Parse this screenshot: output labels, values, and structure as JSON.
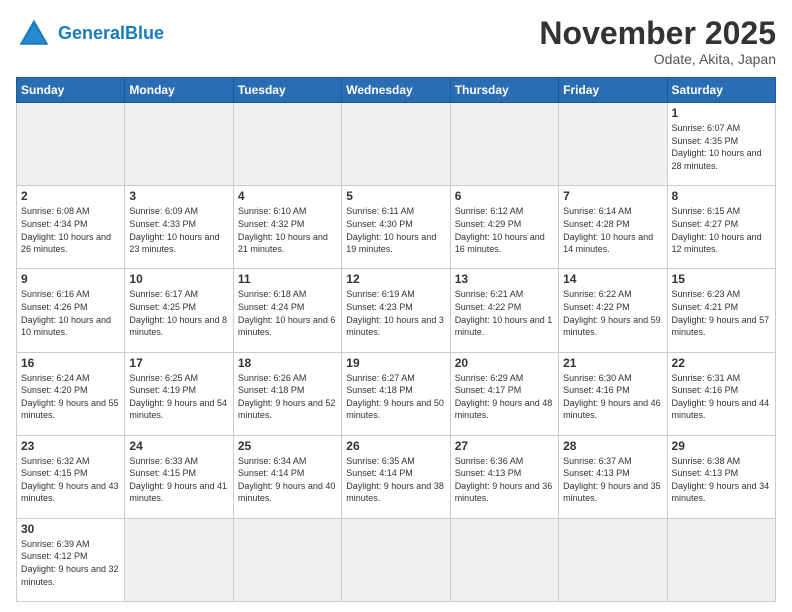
{
  "header": {
    "logo_general": "General",
    "logo_blue": "Blue",
    "month_title": "November 2025",
    "location": "Odate, Akita, Japan"
  },
  "days_of_week": [
    "Sunday",
    "Monday",
    "Tuesday",
    "Wednesday",
    "Thursday",
    "Friday",
    "Saturday"
  ],
  "weeks": [
    [
      {
        "day": "",
        "empty": true
      },
      {
        "day": "",
        "empty": true
      },
      {
        "day": "",
        "empty": true
      },
      {
        "day": "",
        "empty": true
      },
      {
        "day": "",
        "empty": true
      },
      {
        "day": "",
        "empty": true
      },
      {
        "day": "1",
        "sunrise": "Sunrise: 6:07 AM",
        "sunset": "Sunset: 4:35 PM",
        "daylight": "Daylight: 10 hours and 28 minutes."
      }
    ],
    [
      {
        "day": "2",
        "sunrise": "Sunrise: 6:08 AM",
        "sunset": "Sunset: 4:34 PM",
        "daylight": "Daylight: 10 hours and 26 minutes."
      },
      {
        "day": "3",
        "sunrise": "Sunrise: 6:09 AM",
        "sunset": "Sunset: 4:33 PM",
        "daylight": "Daylight: 10 hours and 23 minutes."
      },
      {
        "day": "4",
        "sunrise": "Sunrise: 6:10 AM",
        "sunset": "Sunset: 4:32 PM",
        "daylight": "Daylight: 10 hours and 21 minutes."
      },
      {
        "day": "5",
        "sunrise": "Sunrise: 6:11 AM",
        "sunset": "Sunset: 4:30 PM",
        "daylight": "Daylight: 10 hours and 19 minutes."
      },
      {
        "day": "6",
        "sunrise": "Sunrise: 6:12 AM",
        "sunset": "Sunset: 4:29 PM",
        "daylight": "Daylight: 10 hours and 16 minutes."
      },
      {
        "day": "7",
        "sunrise": "Sunrise: 6:14 AM",
        "sunset": "Sunset: 4:28 PM",
        "daylight": "Daylight: 10 hours and 14 minutes."
      },
      {
        "day": "8",
        "sunrise": "Sunrise: 6:15 AM",
        "sunset": "Sunset: 4:27 PM",
        "daylight": "Daylight: 10 hours and 12 minutes."
      }
    ],
    [
      {
        "day": "9",
        "sunrise": "Sunrise: 6:16 AM",
        "sunset": "Sunset: 4:26 PM",
        "daylight": "Daylight: 10 hours and 10 minutes."
      },
      {
        "day": "10",
        "sunrise": "Sunrise: 6:17 AM",
        "sunset": "Sunset: 4:25 PM",
        "daylight": "Daylight: 10 hours and 8 minutes."
      },
      {
        "day": "11",
        "sunrise": "Sunrise: 6:18 AM",
        "sunset": "Sunset: 4:24 PM",
        "daylight": "Daylight: 10 hours and 6 minutes."
      },
      {
        "day": "12",
        "sunrise": "Sunrise: 6:19 AM",
        "sunset": "Sunset: 4:23 PM",
        "daylight": "Daylight: 10 hours and 3 minutes."
      },
      {
        "day": "13",
        "sunrise": "Sunrise: 6:21 AM",
        "sunset": "Sunset: 4:22 PM",
        "daylight": "Daylight: 10 hours and 1 minute."
      },
      {
        "day": "14",
        "sunrise": "Sunrise: 6:22 AM",
        "sunset": "Sunset: 4:22 PM",
        "daylight": "Daylight: 9 hours and 59 minutes."
      },
      {
        "day": "15",
        "sunrise": "Sunrise: 6:23 AM",
        "sunset": "Sunset: 4:21 PM",
        "daylight": "Daylight: 9 hours and 57 minutes."
      }
    ],
    [
      {
        "day": "16",
        "sunrise": "Sunrise: 6:24 AM",
        "sunset": "Sunset: 4:20 PM",
        "daylight": "Daylight: 9 hours and 55 minutes."
      },
      {
        "day": "17",
        "sunrise": "Sunrise: 6:25 AM",
        "sunset": "Sunset: 4:19 PM",
        "daylight": "Daylight: 9 hours and 54 minutes."
      },
      {
        "day": "18",
        "sunrise": "Sunrise: 6:26 AM",
        "sunset": "Sunset: 4:18 PM",
        "daylight": "Daylight: 9 hours and 52 minutes."
      },
      {
        "day": "19",
        "sunrise": "Sunrise: 6:27 AM",
        "sunset": "Sunset: 4:18 PM",
        "daylight": "Daylight: 9 hours and 50 minutes."
      },
      {
        "day": "20",
        "sunrise": "Sunrise: 6:29 AM",
        "sunset": "Sunset: 4:17 PM",
        "daylight": "Daylight: 9 hours and 48 minutes."
      },
      {
        "day": "21",
        "sunrise": "Sunrise: 6:30 AM",
        "sunset": "Sunset: 4:16 PM",
        "daylight": "Daylight: 9 hours and 46 minutes."
      },
      {
        "day": "22",
        "sunrise": "Sunrise: 6:31 AM",
        "sunset": "Sunset: 4:16 PM",
        "daylight": "Daylight: 9 hours and 44 minutes."
      }
    ],
    [
      {
        "day": "23",
        "sunrise": "Sunrise: 6:32 AM",
        "sunset": "Sunset: 4:15 PM",
        "daylight": "Daylight: 9 hours and 43 minutes."
      },
      {
        "day": "24",
        "sunrise": "Sunrise: 6:33 AM",
        "sunset": "Sunset: 4:15 PM",
        "daylight": "Daylight: 9 hours and 41 minutes."
      },
      {
        "day": "25",
        "sunrise": "Sunrise: 6:34 AM",
        "sunset": "Sunset: 4:14 PM",
        "daylight": "Daylight: 9 hours and 40 minutes."
      },
      {
        "day": "26",
        "sunrise": "Sunrise: 6:35 AM",
        "sunset": "Sunset: 4:14 PM",
        "daylight": "Daylight: 9 hours and 38 minutes."
      },
      {
        "day": "27",
        "sunrise": "Sunrise: 6:36 AM",
        "sunset": "Sunset: 4:13 PM",
        "daylight": "Daylight: 9 hours and 36 minutes."
      },
      {
        "day": "28",
        "sunrise": "Sunrise: 6:37 AM",
        "sunset": "Sunset: 4:13 PM",
        "daylight": "Daylight: 9 hours and 35 minutes."
      },
      {
        "day": "29",
        "sunrise": "Sunrise: 6:38 AM",
        "sunset": "Sunset: 4:13 PM",
        "daylight": "Daylight: 9 hours and 34 minutes."
      }
    ],
    [
      {
        "day": "30",
        "sunrise": "Sunrise: 6:39 AM",
        "sunset": "Sunset: 4:12 PM",
        "daylight": "Daylight: 9 hours and 32 minutes."
      },
      {
        "day": "",
        "empty": true
      },
      {
        "day": "",
        "empty": true
      },
      {
        "day": "",
        "empty": true
      },
      {
        "day": "",
        "empty": true
      },
      {
        "day": "",
        "empty": true
      },
      {
        "day": "",
        "empty": true
      }
    ]
  ]
}
